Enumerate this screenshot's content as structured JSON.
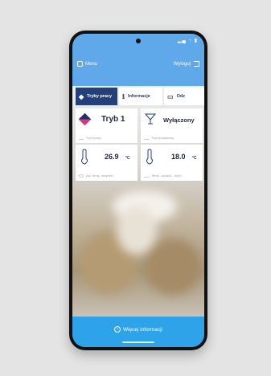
{
  "header": {
    "menu_label": "Menu",
    "logout_label": "Wyloguj"
  },
  "tabs": [
    {
      "label": "Tryby pracy",
      "icon": "diamond-icon",
      "active": true
    },
    {
      "label": "Informacje",
      "icon": "info-icon",
      "active": false
    },
    {
      "label": "Odz",
      "icon": "calendar-icon",
      "active": false
    }
  ],
  "cards": {
    "mode": {
      "value": "Tryb 1",
      "label": "Tryb pracy"
    },
    "extra": {
      "value": "Wyłączony",
      "label": "Tryb dodatkowy"
    },
    "room_temp": {
      "value": "26.9",
      "unit": "°C",
      "label": "Akt. temp. wnętrza"
    },
    "set_temp": {
      "value": "18.0",
      "unit": "°C",
      "label": "Temp. zadana - tryb1"
    }
  },
  "footer": {
    "more_label": "Więcej informacji"
  },
  "colors": {
    "accent": "#2ea3ea",
    "tab_active": "#24407a",
    "header": "#5fa8ea"
  }
}
